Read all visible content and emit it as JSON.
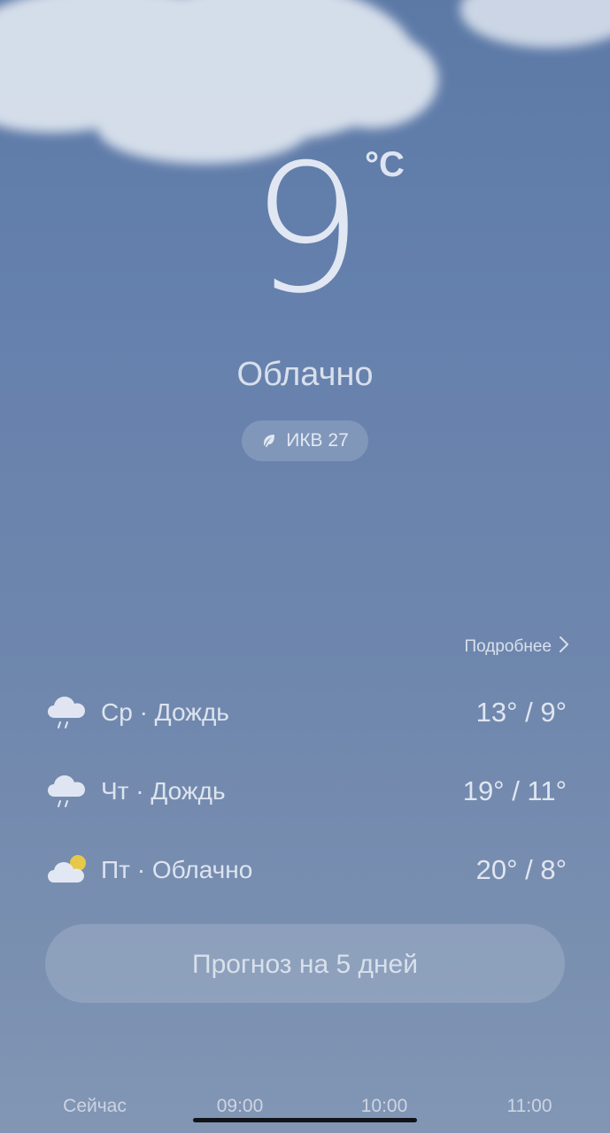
{
  "current": {
    "temperature": "9",
    "unit": "°C",
    "condition": "Облачно",
    "aqi_label": "ИКВ 27"
  },
  "details_link": "Подробнее",
  "forecast": [
    {
      "day": "Ср · Дождь",
      "range": "13° / 9°",
      "icon": "rain-cloud-icon"
    },
    {
      "day": "Чт · Дождь",
      "range": "19° / 11°",
      "icon": "rain-cloud-icon"
    },
    {
      "day": "Пт · Облачно",
      "range": "20° / 8°",
      "icon": "partly-cloudy-icon"
    }
  ],
  "five_day_button": "Прогноз на 5 дней",
  "hourly": [
    {
      "time": "Сейчас"
    },
    {
      "time": "09:00"
    },
    {
      "time": "10:00"
    },
    {
      "time": "11:00"
    }
  ],
  "colors": {
    "sky_top": "#5c79a6",
    "sky_bottom": "#8296b4",
    "text": "#e9edf5",
    "sun": "#e6c84a"
  }
}
